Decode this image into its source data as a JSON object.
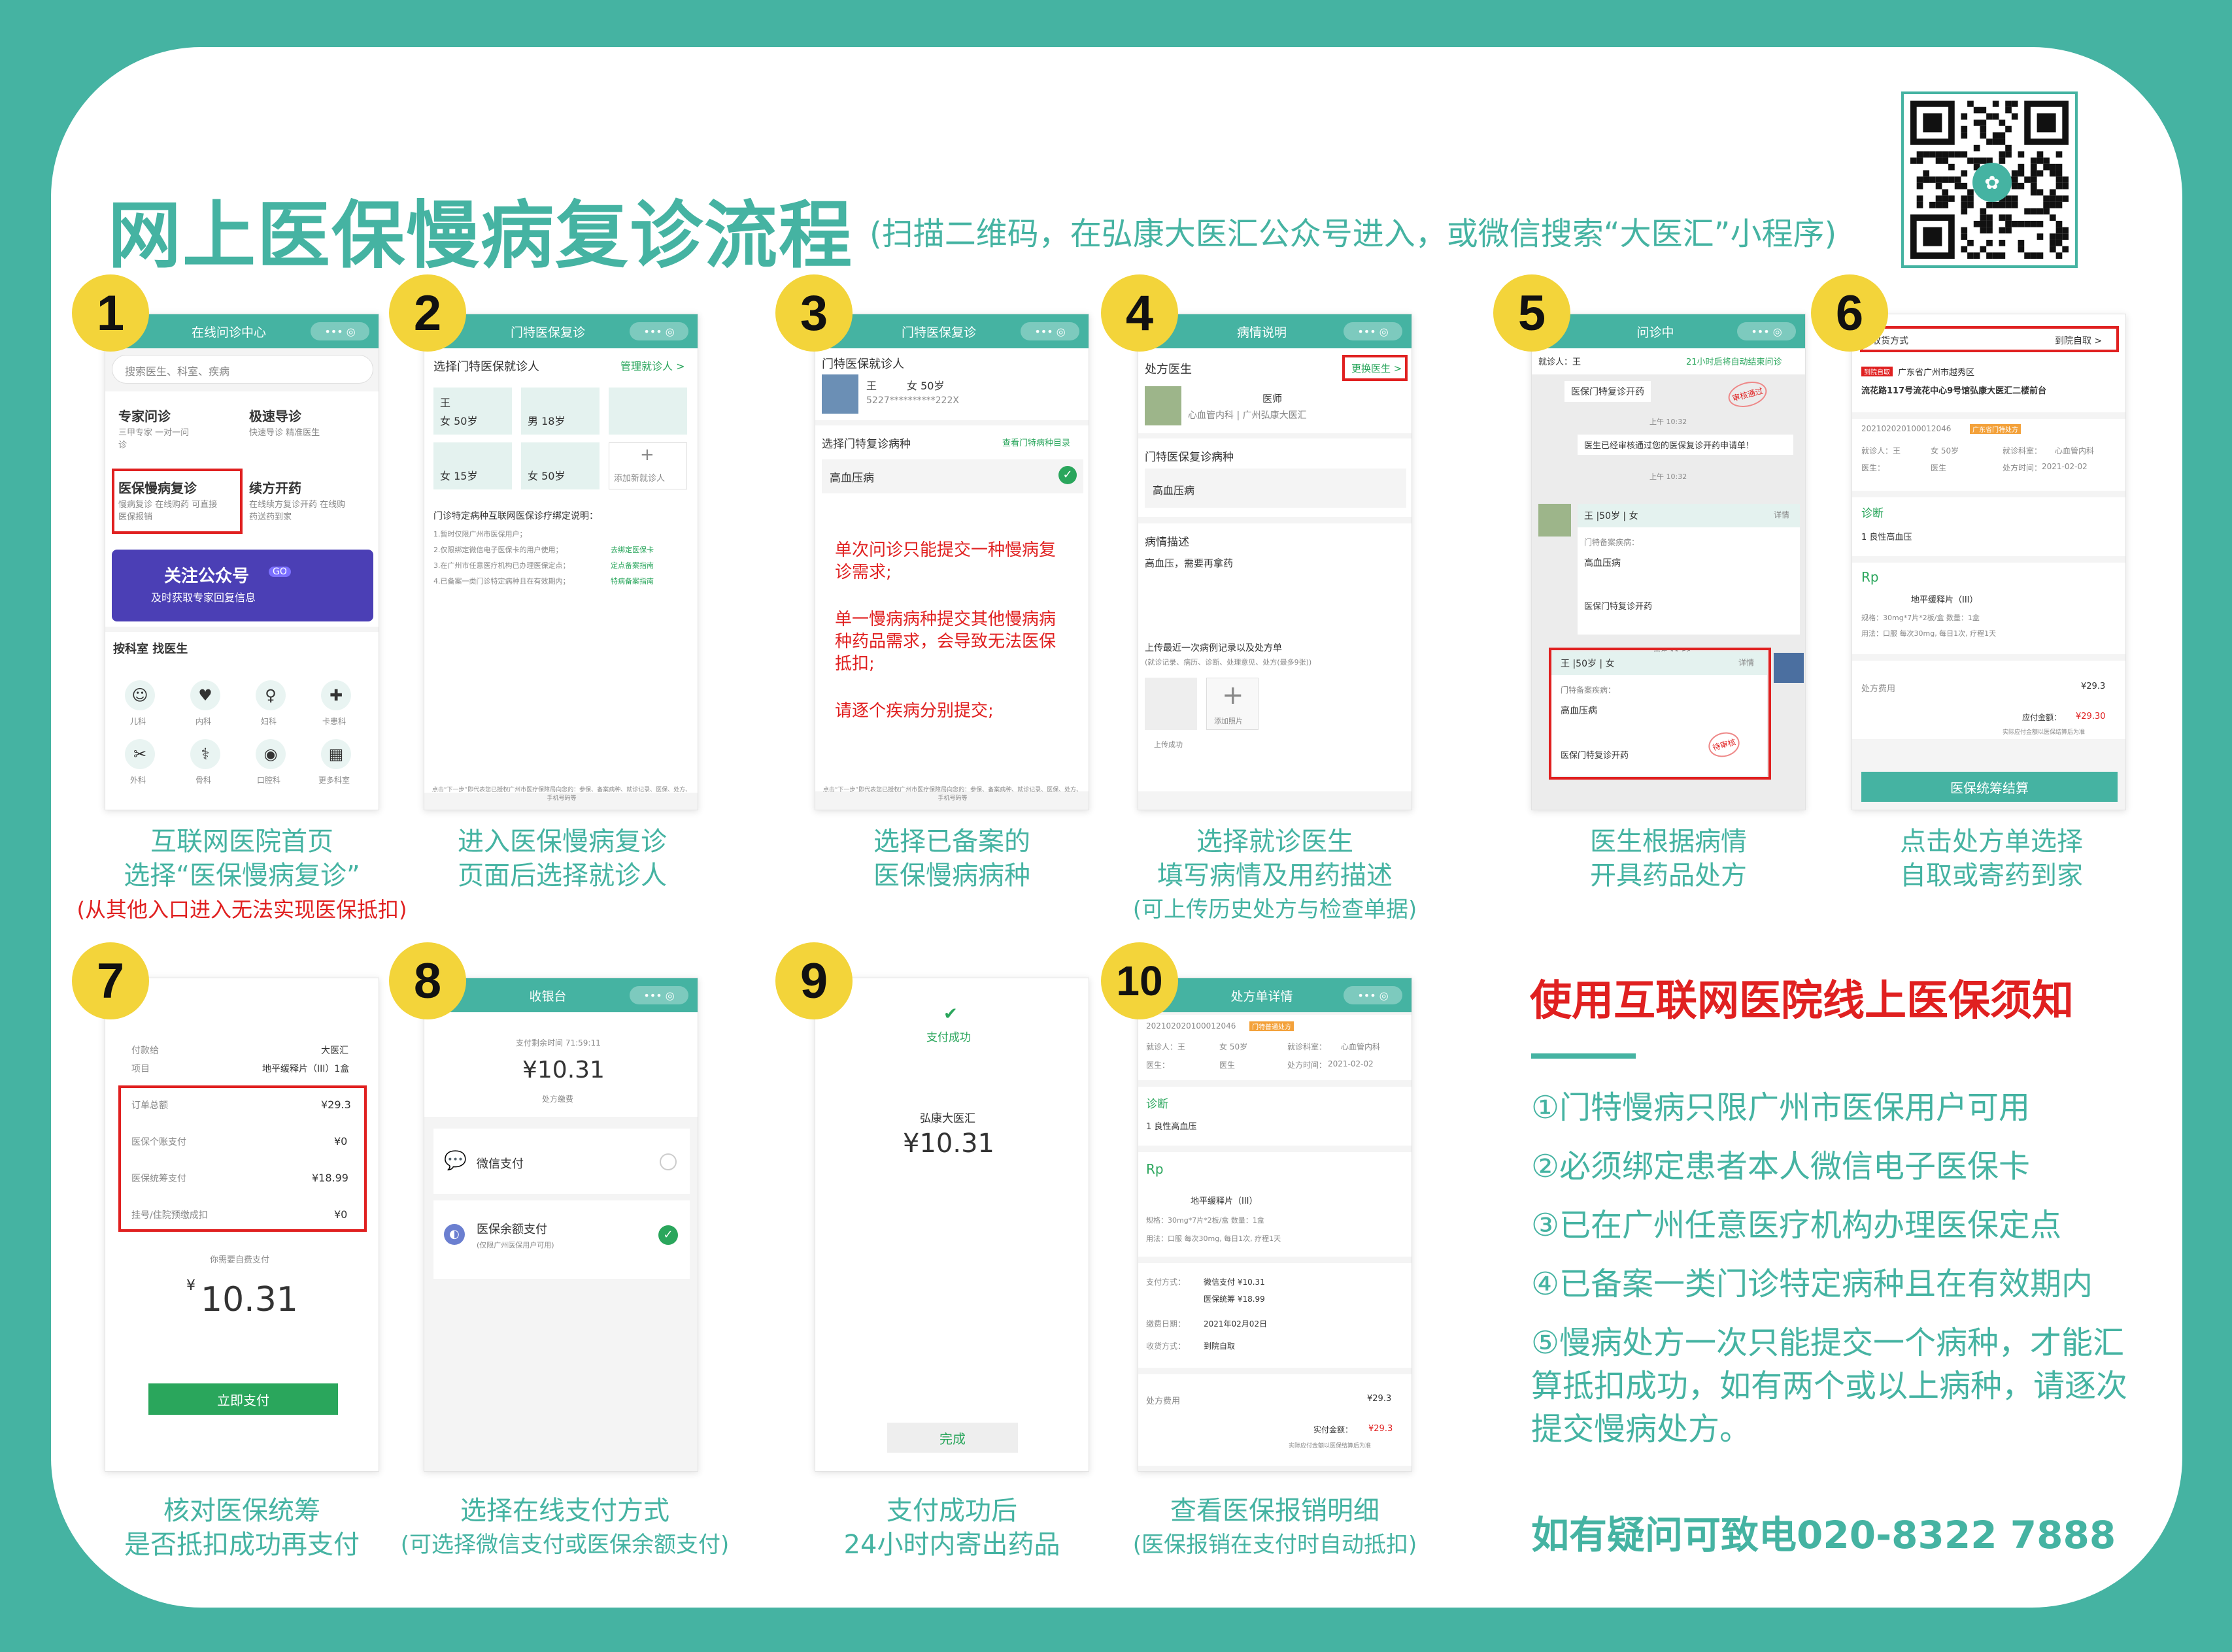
{
  "header": {
    "title": "网上医保慢病复诊流程",
    "subtitle": "(扫描二维码，在弘康大医汇公众号进入，或微信搜索“大医汇”小程序)"
  },
  "steps": [
    {
      "num": "1",
      "caption": [
        "互联网医院首页",
        "选择“医保慢病复诊”"
      ],
      "note": "(从其他入口进入无法实现医保抵扣)"
    },
    {
      "num": "2",
      "caption": [
        "进入医保慢病复诊",
        "页面后选择就诊人"
      ]
    },
    {
      "num": "3",
      "caption": [
        "选择已备案的",
        "医保慢病病种"
      ]
    },
    {
      "num": "4",
      "caption": [
        "选择就诊医生",
        "填写病情及用药描述"
      ],
      "note": "(可上传历史处方与检查单据)"
    },
    {
      "num": "5",
      "caption": [
        "医生根据病情",
        "开具药品处方"
      ]
    },
    {
      "num": "6",
      "caption": [
        "点击处方单选择",
        "自取或寄药到家"
      ]
    },
    {
      "num": "7",
      "caption": [
        "核对医保统筹",
        "是否抵扣成功再支付"
      ]
    },
    {
      "num": "8",
      "caption": [
        "选择在线支付方式"
      ],
      "note": "(可选择微信支付或医保余额支付)"
    },
    {
      "num": "9",
      "caption": [
        "支付成功后",
        "24小时内寄出药品"
      ]
    },
    {
      "num": "10",
      "caption": [
        "查看医保报销明细"
      ],
      "note": "(医保报销在支付时自动抵扣)"
    }
  ],
  "screens": {
    "s1": {
      "bar": "在线问诊中心",
      "search_placeholder": "搜索医生、科室、疾病",
      "tiles": [
        {
          "t": "专家问诊",
          "d": "三甲专家 一对一问诊"
        },
        {
          "t": "极速导诊",
          "d": "快速导诊 精准医生"
        },
        {
          "t": "医保慢病复诊",
          "d": "慢病复诊 在线购药 可直接医保报销"
        },
        {
          "t": "续方开药",
          "d": "在线续方复诊开药 在线购药送药到家"
        }
      ],
      "banner_title": "关注公众号",
      "banner_go": "GO",
      "banner_sub": "及时获取专家回复信息",
      "section": "按科室 找医生",
      "depts": [
        "儿科",
        "内科",
        "妇科",
        "卡患科",
        "外科",
        "骨科",
        "口腔科",
        "更多科室"
      ]
    },
    "s2": {
      "bar": "门特医保复诊",
      "head": "选择门特医保就诊人",
      "manage": "管理就诊人 >",
      "patients": [
        {
          "name": "王",
          "info": "女 50岁"
        },
        {
          "name": "",
          "info": "男 18岁"
        },
        {
          "name": "",
          "info": "女 15岁"
        },
        {
          "name": "",
          "info": "女 50岁"
        }
      ],
      "add": "添加新就诊人",
      "notes_head": "门诊特定病种互联网医保诊疗绑定说明：",
      "notes": [
        "1.暂时仅限广州市医保用户；",
        "2.仅限绑定微信电子医保卡的用户使用；",
        "3.在广州市任意医疗机构已办理医保定点；",
        "4.已备案一类门诊特定病种且在有效期内；"
      ],
      "note_links": [
        "去绑定医保卡",
        "定点备案指南",
        "特病备案指南"
      ],
      "footer": "点击“下一步”即代表您已授权广州市医疗保障局向您的：参保、备案病种、就诊记录、医保、处方、手机号码等"
    },
    "s3": {
      "bar": "门特医保复诊",
      "head": "门特医保就诊人",
      "name": "王",
      "info": "女 50岁",
      "id": "5227**********222X",
      "pick": "选择门特复诊病种",
      "pick_link": "查看门特病种目录",
      "disease": "高血压病",
      "warn1": "单次问诊只能提交一种慢病复诊需求;",
      "warn2": "单一慢病病种提交其他慢病病种药品需求，会导致无法医保抵扣;",
      "warn3": "请逐个疾病分别提交;",
      "footer": "点击“下一步”即代表您已授权广州市医疗保障局向您的：参保、备案病种、就诊记录、医保、处方、手机号码等"
    },
    "s4": {
      "bar": "病情说明",
      "doc_head": "处方医生",
      "change": "更换医生 >",
      "doc_title": "医师",
      "doc_dept": "心血管内科 | 广州弘康大医汇",
      "dis_head": "门特医保复诊病种",
      "disease": "高血压病",
      "desc_head": "病情描述",
      "desc": "高血压，需要再拿药",
      "upload": "上传最近一次病例记录以及处方单",
      "upload_sub": "(就诊记录、病历、诊断、处理意见、处方(最多9张))",
      "add_pic": "添加照片",
      "uploaded": "上传成功"
    },
    "s5": {
      "bar": "问诊中",
      "banner": "21小时后将自动结束问诊",
      "patient": "就诊人：王",
      "msg1": "医保门特复诊开药",
      "stamp1": "审核通过",
      "time1": "上午 10:32",
      "time2": "上午 10:32",
      "doctor_msg": "医生已经审核通过您的医保复诊开药申请单！",
      "card_name": "王 |50岁 | 女",
      "card_detail": "详情",
      "card_label": "门特备案疾病：",
      "card_dis": "高血压病",
      "card_btn": "医保门特复诊开药",
      "time3": "中午 11:56",
      "card2_name": "王 |50岁 | 女",
      "card2_label": "门特备案疾病：",
      "card2_dis": "高血压病",
      "card2_btn": "医保门特复诊开药",
      "stamp2": "待审核"
    },
    "s6": {
      "deliver": "收货方式",
      "deliver_val": "到院自取 >",
      "tag": "到院自取",
      "addr1": "广东省广州市越秀区",
      "addr2": "流花路117号流花中心9号馆弘康大医汇二楼前台",
      "no": "202102020100012046",
      "no_tag": "广东省门特处方",
      "patient": "就诊人：王",
      "pinfo": "女 50岁",
      "dept_l": "就诊科室：",
      "dept": "心血管内科",
      "doc_l": "医生：",
      "doc": "医生",
      "date_l": "处方时间：",
      "date": "2021-02-02",
      "diag_head": "诊断",
      "diag": "1 良性高血压",
      "rp": "Rp",
      "drug": "地平缓释片（III）",
      "spec": "规格：30mg*7片*2板/盒   数量：1盒",
      "usage": "用法：口服 每次30mg, 每日1次, 疗程1天",
      "fee_l": "处方费用",
      "fee": "¥29.3",
      "pay_l": "应付金额：",
      "pay": "¥29.30",
      "pay_note": "实际应付金额以医保结算后为准",
      "btn": "医保统筹结算"
    },
    "s7": {
      "payee_l": "付款给",
      "payee": "大医汇",
      "item_l": "项目",
      "item": "地平缓释片（III）1盒",
      "rows": [
        {
          "l": "订单总额",
          "v": "¥29.3"
        },
        {
          "l": "医保个账支付",
          "v": "¥0"
        },
        {
          "l": "医保统筹支付",
          "v": "¥18.99"
        },
        {
          "l": "挂号/住院预缴成扣",
          "v": "¥0"
        }
      ],
      "self_l": "你需要自费支付",
      "amount": "10.31",
      "yen": "¥",
      "btn": "立即支付"
    },
    "s8": {
      "bar": "收银台",
      "remain": "支付剩余时间 71:59:11",
      "amount": "¥10.31",
      "desc": "处方缴费",
      "wx": "微信支付",
      "yb": "医保余额支付",
      "yb_sub": "(仅限广州医保用户可用)"
    },
    "s9": {
      "success": "支付成功",
      "payee": "弘康大医汇",
      "amount": "¥10.31",
      "btn": "完成"
    },
    "s10": {
      "bar": "处方单详情",
      "no": "202102020100012046",
      "no_tag": "门特普通处方",
      "patient": "就诊人：王",
      "pinfo": "女 50岁",
      "dept_l": "就诊科室：",
      "dept": "心血管内科",
      "doc_l": "医生：",
      "doc": "医生",
      "date_l": "处方时间：",
      "date": "2021-02-02",
      "diag_head": "诊断",
      "diag": "1 良性高血压",
      "rp": "Rp",
      "drug": "地平缓释片（III）",
      "spec": "规格：30mg*7片*2板/盒   数量：1盒",
      "usage": "用法：口服 每次30mg, 每日1次, 疗程1天",
      "pay_l": "支付方式：",
      "pay1": "微信支付 ¥10.31",
      "pay2": "医保统筹 ¥18.99",
      "paydate_l": "缴费日期：",
      "paydate": "2021年02月02日",
      "recv_l": "收货方式：",
      "recv": "到院自取",
      "fee_l": "处方费用",
      "fee": "¥29.3",
      "paid_l": "实付金额：",
      "paid": "¥29.3",
      "paid_note": "实际应付金额以医保结算后为准"
    }
  },
  "notice": {
    "title": "使用互联网医院线上医保须知",
    "items": [
      "①门特慢病只限广州市医保用户可用",
      "②必须绑定患者本人微信电子医保卡",
      "③已在广州任意医疗机构办理医保定点",
      "④已备案一类门诊特定病种且在有效期内",
      "⑤慢病处方一次只能提交一个病种，才能汇算抵扣成功，如有两个或以上病种，请逐次提交慢病处方。"
    ],
    "contact": "如有疑问可致电020-8322 7888"
  },
  "colors": {
    "teal": "#45b3a2",
    "yellow": "#f3d43a",
    "red": "#e02020",
    "green": "#2aa65c"
  }
}
